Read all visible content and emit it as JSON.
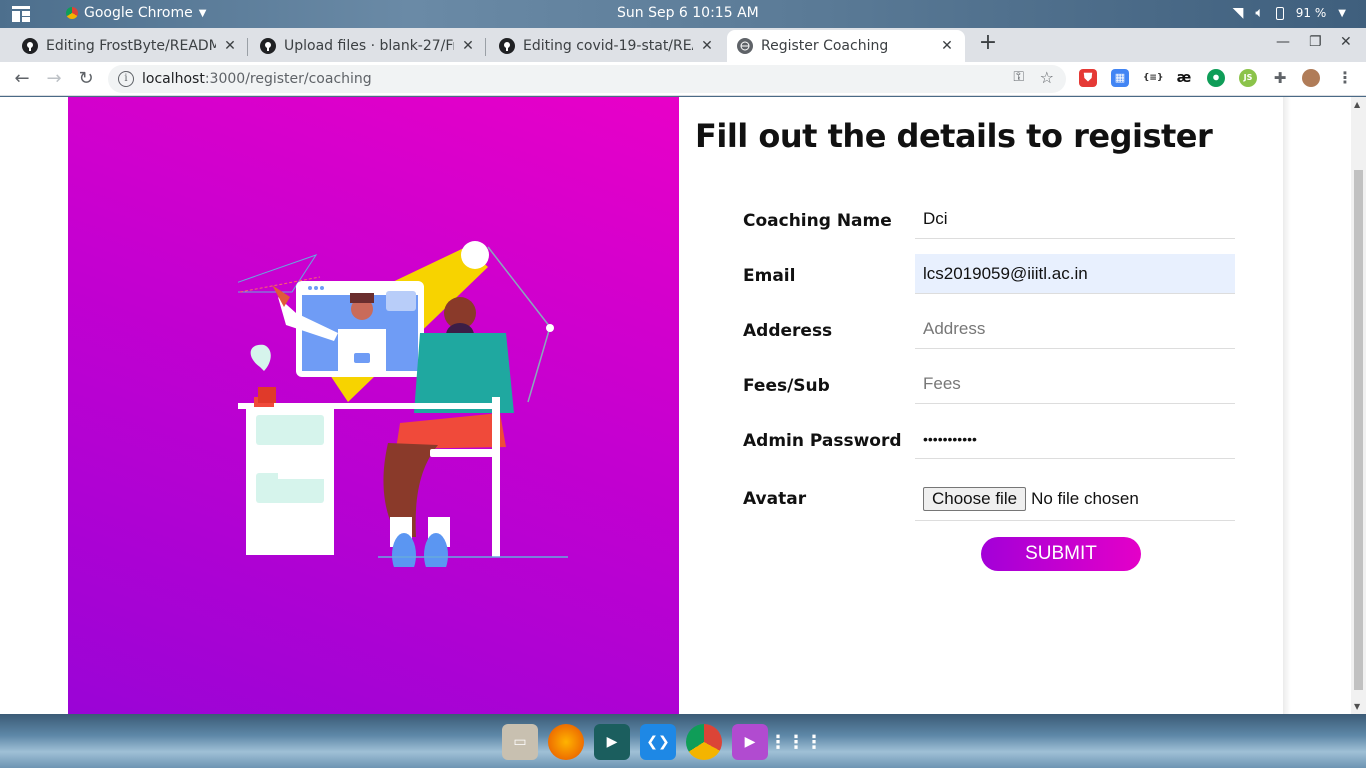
{
  "system": {
    "app_name": "Google Chrome",
    "clock": "Sun Sep 6  10:15 AM",
    "battery": "91 %"
  },
  "tabs": [
    {
      "title": "Editing FrostByte/READM",
      "icon": "github-icon"
    },
    {
      "title": "Upload files · blank-27/Fro",
      "icon": "github-icon"
    },
    {
      "title": "Editing covid-19-stat/REA",
      "icon": "github-icon"
    },
    {
      "title": "Register Coaching",
      "icon": "globe-icon",
      "active": true
    }
  ],
  "address": {
    "host": "localhost",
    "path": ":3000/register/coaching"
  },
  "form": {
    "title": "Fill out the details to register",
    "fields": [
      {
        "label": "Coaching Name",
        "value": "Dci",
        "placeholder": ""
      },
      {
        "label": "Email",
        "value": "lcs2019059@iiitl.ac.in",
        "placeholder": ""
      },
      {
        "label": "Adderess",
        "value": "",
        "placeholder": "Address"
      },
      {
        "label": "Fees/Sub",
        "value": "",
        "placeholder": "Fees"
      },
      {
        "label": "Admin Password",
        "value": "•••••••••••",
        "placeholder": ""
      },
      {
        "label": "Avatar",
        "file_button": "Choose file",
        "file_status": "No file chosen"
      }
    ],
    "submit_label": "SUBMIT"
  },
  "colors": {
    "gradient_top": "#e800c8",
    "gradient_bottom": "#9a04d6",
    "autofill_bg": "#e8f0fe"
  }
}
